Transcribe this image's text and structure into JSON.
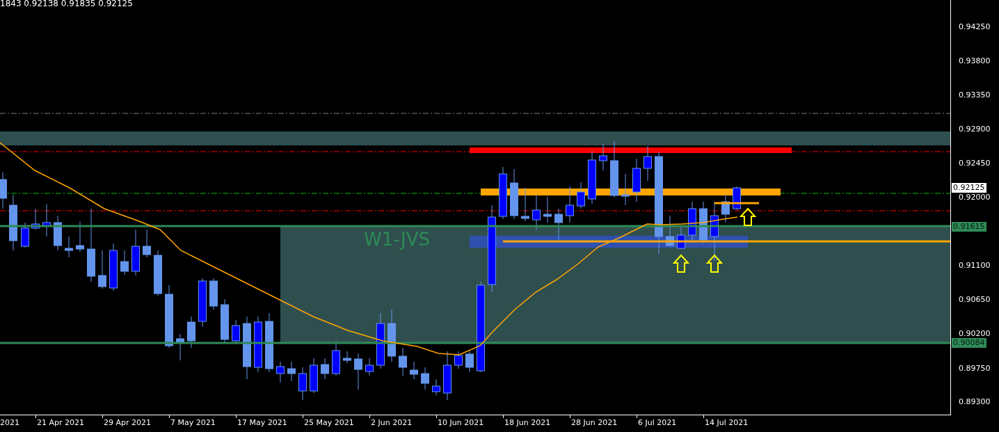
{
  "quote_readout": "1843 0.92138 0.91835 0.92125",
  "zone_label": "W1-JVS",
  "price_axis": {
    "ticks": [
      "0.94250",
      "0.93800",
      "0.93350",
      "0.92900",
      "0.92450",
      "0.92000",
      "0.91100",
      "0.90650",
      "0.90200",
      "0.89750",
      "0.89300"
    ],
    "markers": [
      {
        "kind": "bid",
        "text": "0.92125"
      },
      {
        "kind": "level",
        "text": "0.91615"
      },
      {
        "kind": "level",
        "text": "0.90084"
      }
    ]
  },
  "time_axis": {
    "labels": [
      "2021",
      "21 Apr 2021",
      "29 Apr 2021",
      "7 May 2021",
      "17 May 2021",
      "25 May 2021",
      "2 Jun 2021",
      "10 Jun 2021",
      "18 Jun 2021",
      "28 Jun 2021",
      "6 Jul 2021",
      "14 Jul 2021"
    ]
  }
}
